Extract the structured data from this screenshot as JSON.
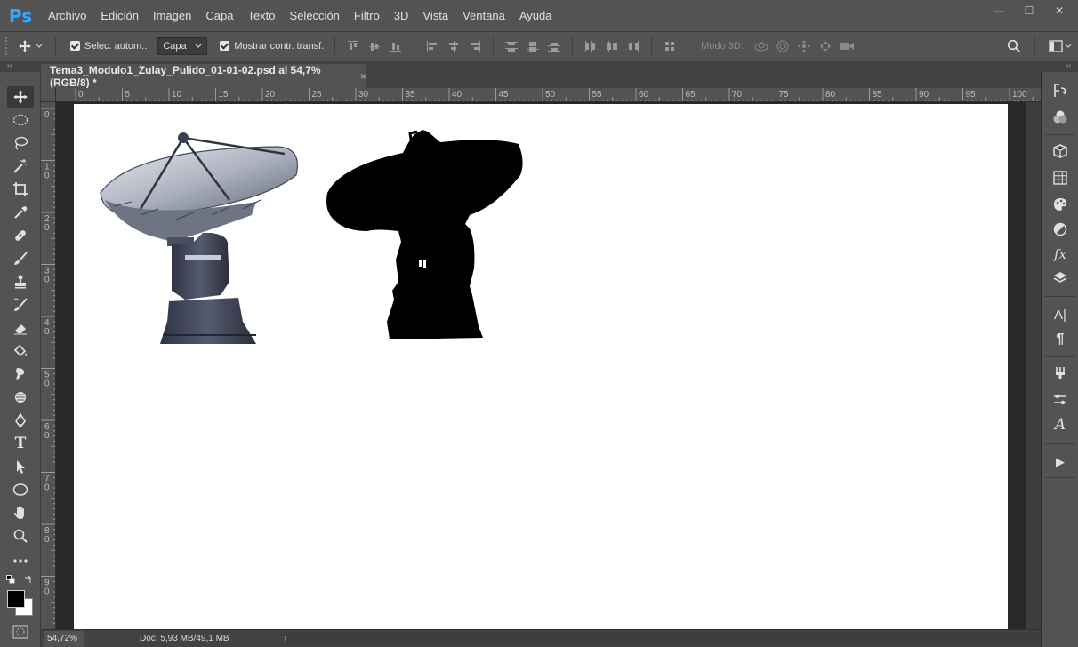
{
  "app": {
    "logo": "Ps"
  },
  "menu": [
    "Archivo",
    "Edición",
    "Imagen",
    "Capa",
    "Texto",
    "Selección",
    "Filtro",
    "3D",
    "Vista",
    "Ventana",
    "Ayuda"
  ],
  "window_controls": {
    "minimize": "—",
    "maximize": "☐",
    "close": "✕"
  },
  "options": {
    "auto_select_label": "Selec. autom.:",
    "auto_select_checked": true,
    "auto_select_value": "Capa",
    "show_transform_label": "Mostrar contr. transf.",
    "show_transform_checked": true,
    "mode_3d_label": "Modo 3D:"
  },
  "panel_toggle": {
    "left": "››",
    "right": "‹‹"
  },
  "document": {
    "tab_title": "Tema3_Modulo1_Zulay_Pulido_01-01-02.psd al 54,7% (RGB/8) *",
    "tab_close": "×"
  },
  "rulers": {
    "top": [
      "0",
      "5",
      "10",
      "15",
      "20",
      "25",
      "30",
      "35",
      "40",
      "45",
      "50",
      "55",
      "60",
      "65",
      "70",
      "75",
      "80",
      "85",
      "90",
      "95",
      "100"
    ],
    "left": [
      "0",
      "1 0",
      "2 0",
      "3 0",
      "4 0",
      "5 0",
      "6 0",
      "7 0",
      "8 0",
      "9 0"
    ]
  },
  "status": {
    "zoom": "54,72%",
    "doc_info": "Doc: 5,93 MB/49,1 MB",
    "arrow": "›"
  },
  "colors": {
    "chrome": "#535353",
    "dark": "#424242",
    "workspace": "#282828",
    "accent": "#31a8ff",
    "foreground": "#000000",
    "background": "#ffffff"
  },
  "tools": [
    "move-icon",
    "ellipse-marquee-icon",
    "lasso-icon",
    "magic-wand-icon",
    "crop-icon",
    "eyedropper-icon",
    "healing-brush-icon",
    "brush-icon",
    "clone-stamp-icon",
    "history-brush-icon",
    "eraser-icon",
    "paint-bucket-icon",
    "smudge-icon",
    "dodge-icon",
    "pen-icon",
    "type-icon",
    "path-selection-icon",
    "ellipse-shape-icon",
    "hand-icon",
    "zoom-icon",
    "more-tools-icon"
  ],
  "type_tool_glyph": "T",
  "right_panels": [
    "history-icon",
    "color-icon",
    "3d-icon",
    "grid-icon",
    "swatches-icon",
    "adjustments-icon",
    "styles-icon",
    "layers-icon",
    "character-icon",
    "paragraph-icon",
    "brush-presets-icon",
    "properties-icon",
    "glyphs-icon",
    "actions-icon"
  ],
  "right_glyphs": {
    "character": "A|",
    "paragraph": "¶",
    "glyphs": "A",
    "actions": "▶",
    "styles": "fx"
  }
}
